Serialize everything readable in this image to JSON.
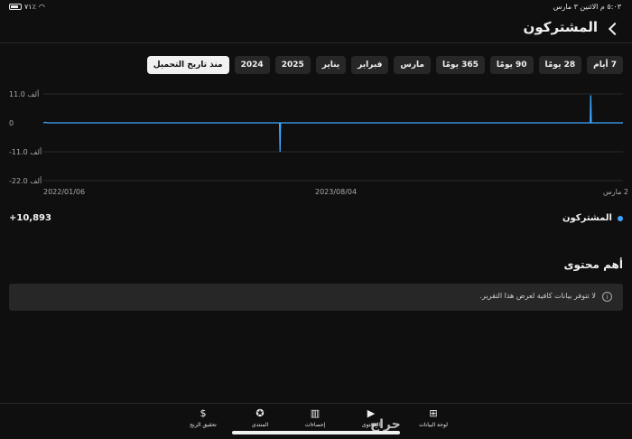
{
  "status_bar": {
    "time": "٥:٠٣ م  الاثنين ٣ مارس",
    "battery": "٧١٪"
  },
  "header": {
    "title": "المشتركون"
  },
  "filters": {
    "chips": [
      {
        "label": "7 أيام",
        "active": false
      },
      {
        "label": "28 يومًا",
        "active": false
      },
      {
        "label": "90 يومًا",
        "active": false
      },
      {
        "label": "365 يومًا",
        "active": false
      },
      {
        "label": "مارس",
        "active": false
      },
      {
        "label": "فبراير",
        "active": false
      },
      {
        "label": "يناير",
        "active": false
      },
      {
        "label": "2025",
        "active": false
      },
      {
        "label": "2024",
        "active": false
      },
      {
        "label": "منذ تاريخ التحميل",
        "active": true
      }
    ]
  },
  "chart_data": {
    "type": "line",
    "y_ticks": [
      "11.0 ألف",
      "0",
      "-11.0 ألف",
      "-22.0 ألف"
    ],
    "y_tick_values": [
      11000,
      0,
      -11000,
      -22000
    ],
    "x_ticks": [
      "2022/01/06",
      "2023/08/04",
      "2 مارس"
    ],
    "ylim": [
      -22000,
      11000
    ],
    "grid": true,
    "series": [
      {
        "name": "المشتركون",
        "color": "#3ea6ff",
        "x": [
          "2022/01/06",
          "2022/01/10",
          "2022/01/14",
          "2023/04/20",
          "2023/04/21",
          "2023/04/22",
          "2024/12/27",
          "2024/12/28",
          "2024/12/29",
          "2025/03/02"
        ],
        "values": [
          0,
          200,
          0,
          0,
          -11000,
          0,
          0,
          10500,
          0,
          0
        ]
      }
    ]
  },
  "legend": {
    "label": "المشتركون",
    "value": "+10,893"
  },
  "top_content": {
    "title": "أهم محتوى",
    "notice_icon": "i",
    "notice": "لا تتوفر بيانات كافية لعرض هذا التقرير."
  },
  "bottom_nav": {
    "items": [
      {
        "label": "لوحة البيانات",
        "icon": "⊞"
      },
      {
        "label": "المحتوى",
        "icon": "▶"
      },
      {
        "label": "إحصاءات",
        "icon": "▥"
      },
      {
        "label": "المنتدى",
        "icon": "✪"
      },
      {
        "label": "تحقيق الربح",
        "icon": "$"
      }
    ]
  },
  "watermark": "حراج"
}
